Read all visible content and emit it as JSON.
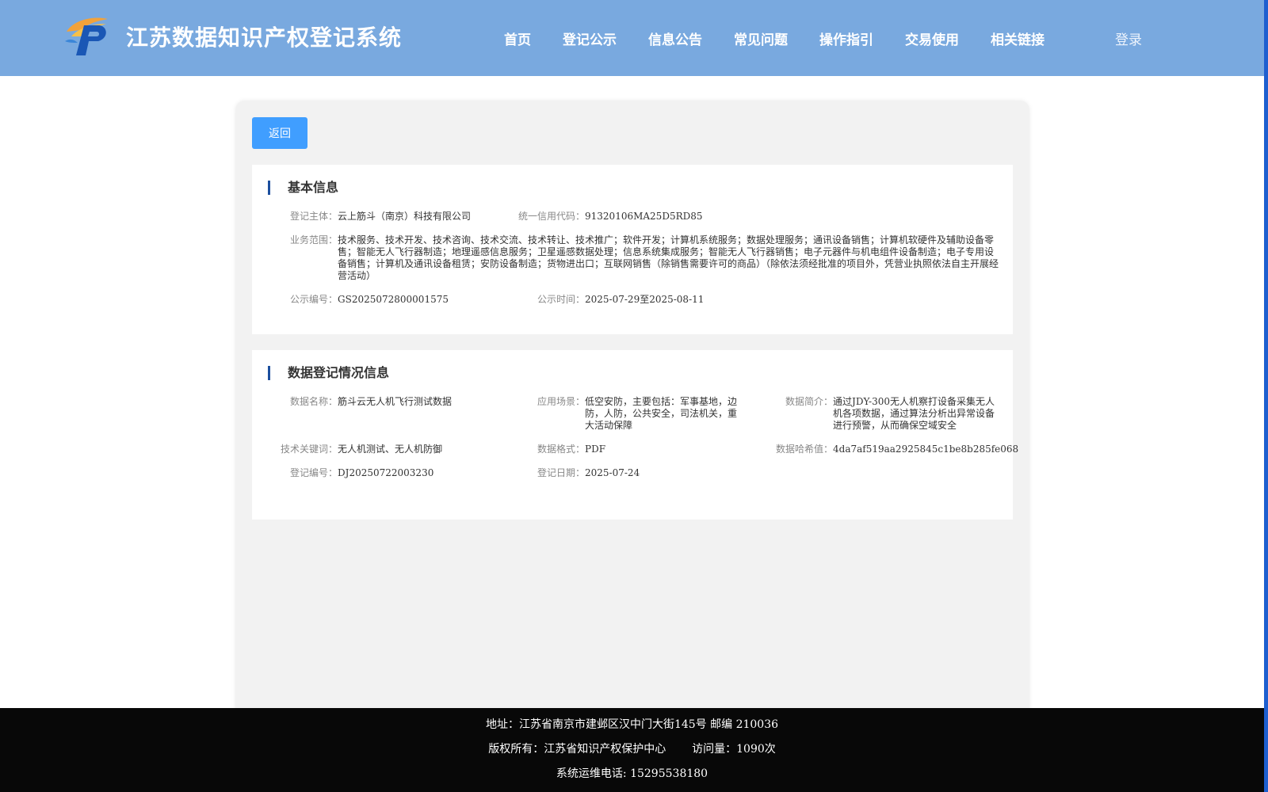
{
  "header": {
    "title": "江苏数据知识产权登记系统",
    "nav": [
      "首页",
      "登记公示",
      "信息公告",
      "常见问题",
      "操作指引",
      "交易使用",
      "相关链接"
    ],
    "login": "登录"
  },
  "actions": {
    "back": "返回"
  },
  "basic_info": {
    "title": "基本信息",
    "subject_label": "登记主体：",
    "subject_value": "云上筋斗（南京）科技有限公司",
    "credit_label": "统一信用代码：",
    "credit_value": "91320106MA25D5RD85",
    "scope_label": "业务范围：",
    "scope_value": "技术服务、技术开发、技术咨询、技术交流、技术转让、技术推广；软件开发；计算机系统服务；数据处理服务；通讯设备销售；计算机软硬件及辅助设备零售；智能无人飞行器制造；地理遥感信息服务；卫星遥感数据处理；信息系统集成服务；智能无人飞行器销售；电子元器件与机电组件设备制造；电子专用设备销售；计算机及通讯设备租赁；安防设备制造；货物进出口；互联网销售（除销售需要许可的商品）（除依法须经批准的项目外，凭营业执照依法自主开展经营活动）",
    "notice_no_label": "公示编号：",
    "notice_no_value": "GS2025072800001575",
    "notice_time_label": "公示时间：",
    "notice_time_value": "2025-07-29至2025-08-11"
  },
  "data_info": {
    "title": "数据登记情况信息",
    "name_label": "数据名称：",
    "name_value": "筋斗云无人机飞行测试数据",
    "scene_label": "应用场景：",
    "scene_value": "低空安防，主要包括：军事基地，边防，人防，公共安全，司法机关，重大活动保障",
    "intro_label": "数据简介：",
    "intro_value": "通过JDY-300无人机察打设备采集无人机各项数据，通过算法分析出异常设备进行预警，从而确保空域安全",
    "keywords_label": "技术关键词：",
    "keywords_value": "无人机测试、无人机防御",
    "format_label": "数据格式：",
    "format_value": "PDF",
    "hash_label": "数据哈希值：",
    "hash_value": "4da7af519aa2925845c1be8b285fe068",
    "reg_no_label": "登记编号：",
    "reg_no_value": "DJ20250722003230",
    "reg_date_label": "登记日期：",
    "reg_date_value": "2025-07-24"
  },
  "footer": {
    "address": "地址：江苏省南京市建邺区汉中门大街145号 邮编 210036",
    "copyright": "版权所有：江苏省知识产权保护中心",
    "visits": "访问量：1090次",
    "hotline": "系统运维电话: 15295538180"
  }
}
